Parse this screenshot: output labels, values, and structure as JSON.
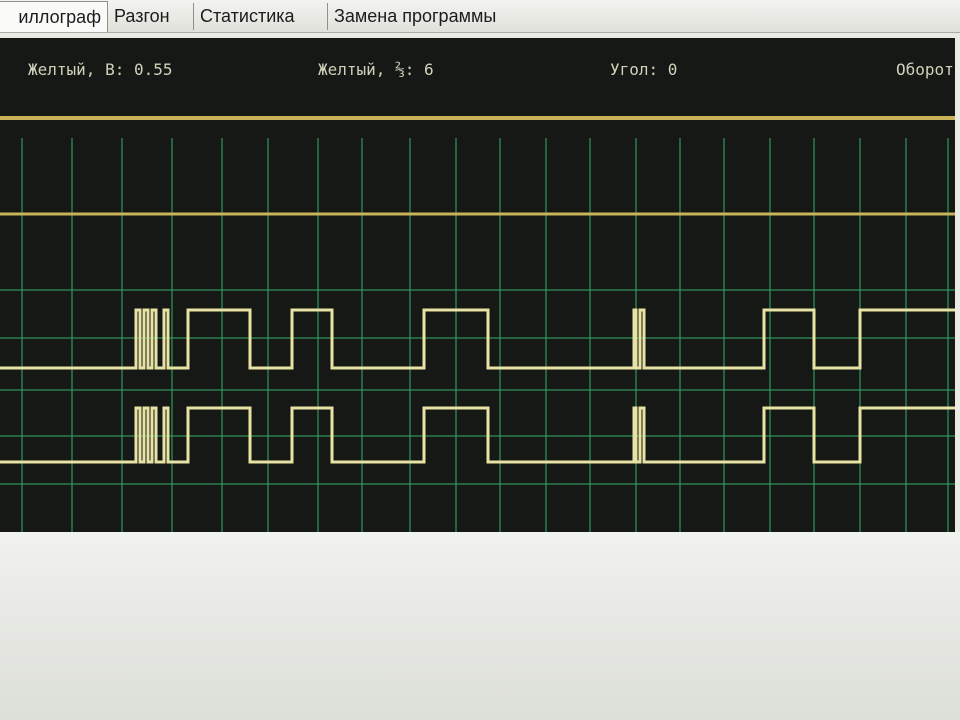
{
  "tabs": [
    {
      "label": "иллограф",
      "active": true
    },
    {
      "label": "Разгон",
      "active": false
    },
    {
      "label": "Статистика",
      "active": false
    },
    {
      "label": "Замена программы",
      "active": false
    }
  ],
  "readouts": {
    "channel_volt": "Желтый, В: 0.55",
    "channel_scale": "Желтый, ⅔: 6",
    "angle": "Угол: 0",
    "rpm": "Оборот"
  },
  "colors": {
    "screen_bg": "#151815",
    "grid": "#2f9a5e",
    "trace": "#e8e3a4",
    "ref_line": "#c9b45a"
  }
}
